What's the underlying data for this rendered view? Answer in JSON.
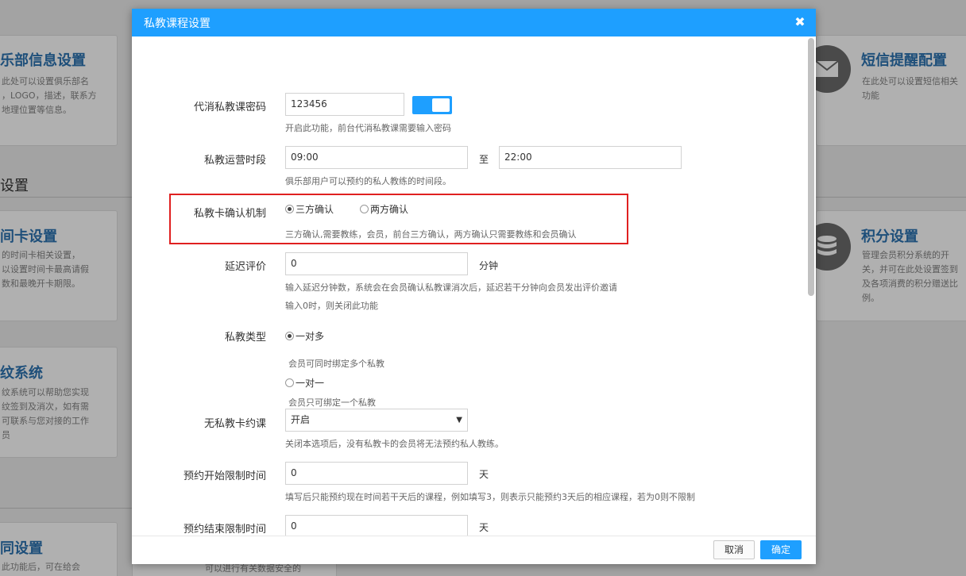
{
  "background": {
    "cards": [
      {
        "title": "乐部信息设置",
        "desc": [
          "此处可以设置俱乐部名",
          "，LOGO，描述，联系方",
          "地理位置等信息。"
        ]
      },
      {
        "title": "短信提醒配置",
        "desc": [
          "在此处可以设置短信相关",
          "功能"
        ]
      },
      {
        "title": "间卡设置",
        "desc": [
          "的时间卡相关设置，",
          "以设置时间卡最高请假",
          "数和最晚开卡期限。"
        ]
      },
      {
        "title": "积分设置",
        "desc": [
          "管理会员积分系统的开",
          "关，并可在此处设置签到",
          "及各项消费的积分赠送比",
          "例。"
        ]
      },
      {
        "title": "纹系统",
        "desc": [
          "纹系统可以帮助您实现",
          "纹签到及消次，如有需",
          "可联系与您对接的工作",
          "员"
        ]
      },
      {
        "title": "同设置",
        "desc": [
          "此功能后，可在给会"
        ]
      }
    ],
    "section_title": "设置",
    "bottom_desc": "可以进行有关数据安全的"
  },
  "modal": {
    "title": "私教课程设置",
    "close_icon": "close-icon",
    "rows": {
      "password": {
        "label": "代消私教课密码",
        "value": "123456",
        "hint": "开启此功能，前台代消私教课需要输入密码",
        "toggle_on": true
      },
      "hours": {
        "label": "私教运营时段",
        "start": "09:00",
        "sep": "至",
        "end": "22:00",
        "hint": "俱乐部用户可以预约的私人教练的时间段。"
      },
      "confirm": {
        "label": "私教卡确认机制",
        "opt1": "三方确认",
        "opt2": "两方确认",
        "hint": "三方确认,需要教练，会员，前台三方确认，两方确认只需要教练和会员确认"
      },
      "delay": {
        "label": "延迟评价",
        "value": "0",
        "unit": "分钟",
        "hint1": "输入延迟分钟数，系统会在会员确认私教课消次后，延迟若干分钟向会员发出评价邀请",
        "hint2": "输入0时，则关闭此功能"
      },
      "type": {
        "label": "私教类型",
        "opt1": "一对多",
        "hint1": "会员可同时绑定多个私教",
        "opt2": "一对一",
        "hint2": "会员只可绑定一个私教"
      },
      "nocard": {
        "label": "无私教卡约课",
        "value": "开启",
        "hint": "关闭本选项后，没有私教卡的会员将无法预约私人教练。"
      },
      "start_limit": {
        "label": "预约开始限制时间",
        "value": "0",
        "unit": "天",
        "hint": "填写后只能预约现在时间若干天后的课程，例如填写3，则表示只能预约3天后的相应课程，若为0则不限制"
      },
      "end_limit": {
        "label": "预约结束限制时间",
        "value": "0",
        "unit": "天"
      }
    },
    "footer": {
      "cancel": "取消",
      "ok": "确定"
    }
  },
  "colors": {
    "accent": "#1e9fff",
    "highlight": "#e02020"
  }
}
